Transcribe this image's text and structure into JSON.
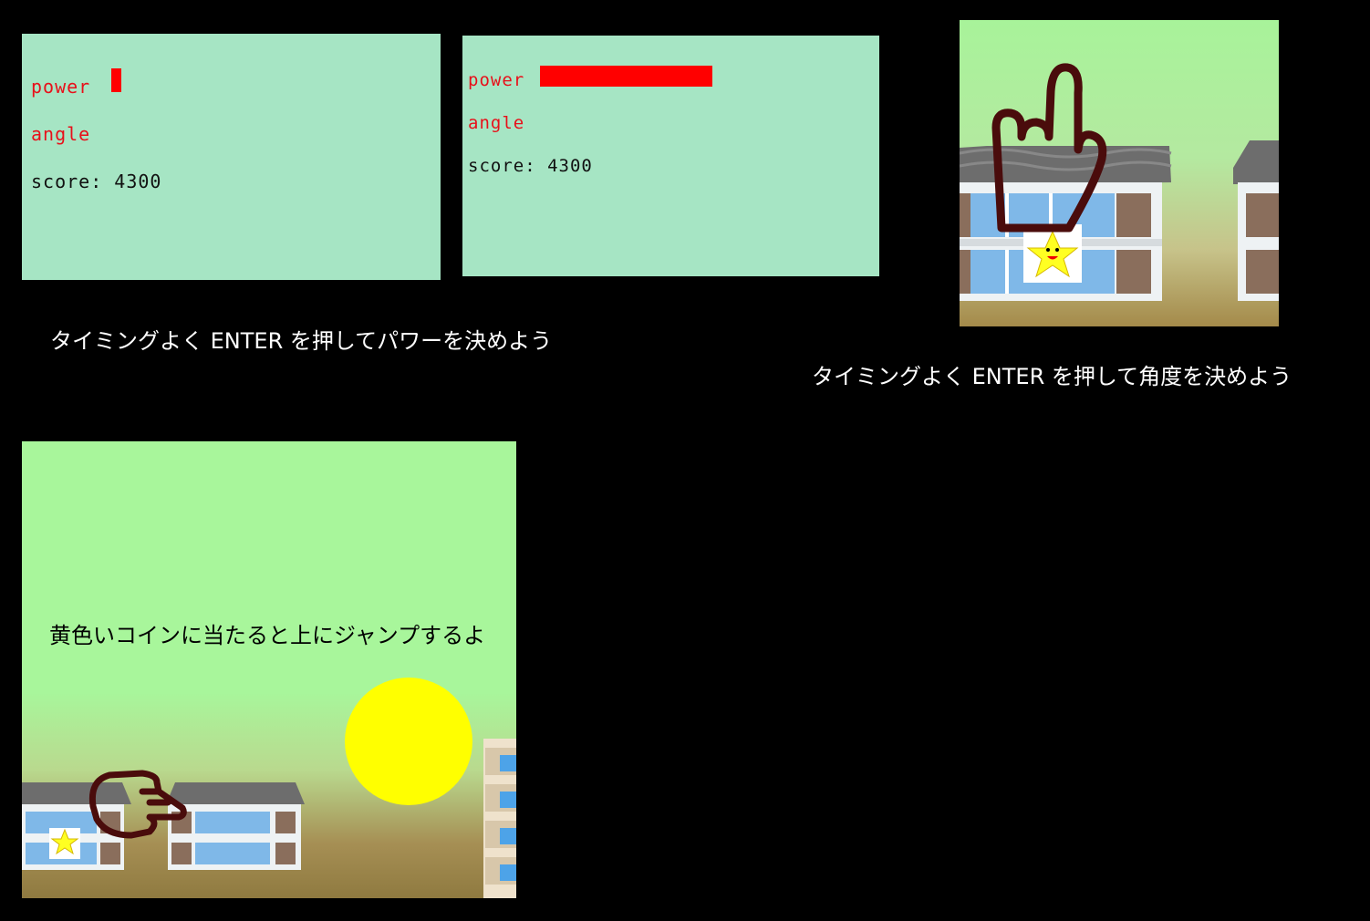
{
  "panel1": {
    "power_label": "power",
    "angle_label": "angle",
    "score_text": "score: 4300",
    "power_fill": 0.06
  },
  "panel2": {
    "power_label": "power",
    "angle_label": "angle",
    "score_text": "score: 4300",
    "power_fill": 1.0
  },
  "captions": {
    "power_tip": "タイミングよく ENTER を押してパワーを決めよう",
    "angle_tip": "タイミングよく ENTER を押して角度を決めよう"
  },
  "scene2": {
    "tip": "黄色いコインに当たると上にジャンプするよ"
  },
  "colors": {
    "hud_bg": "#a6e5c4",
    "accent_red": "#ff0000",
    "coin": "#ffff00"
  },
  "icons": [
    "pointing-hand-icon",
    "star-character-icon",
    "coin-icon",
    "house-icon",
    "building-icon"
  ]
}
